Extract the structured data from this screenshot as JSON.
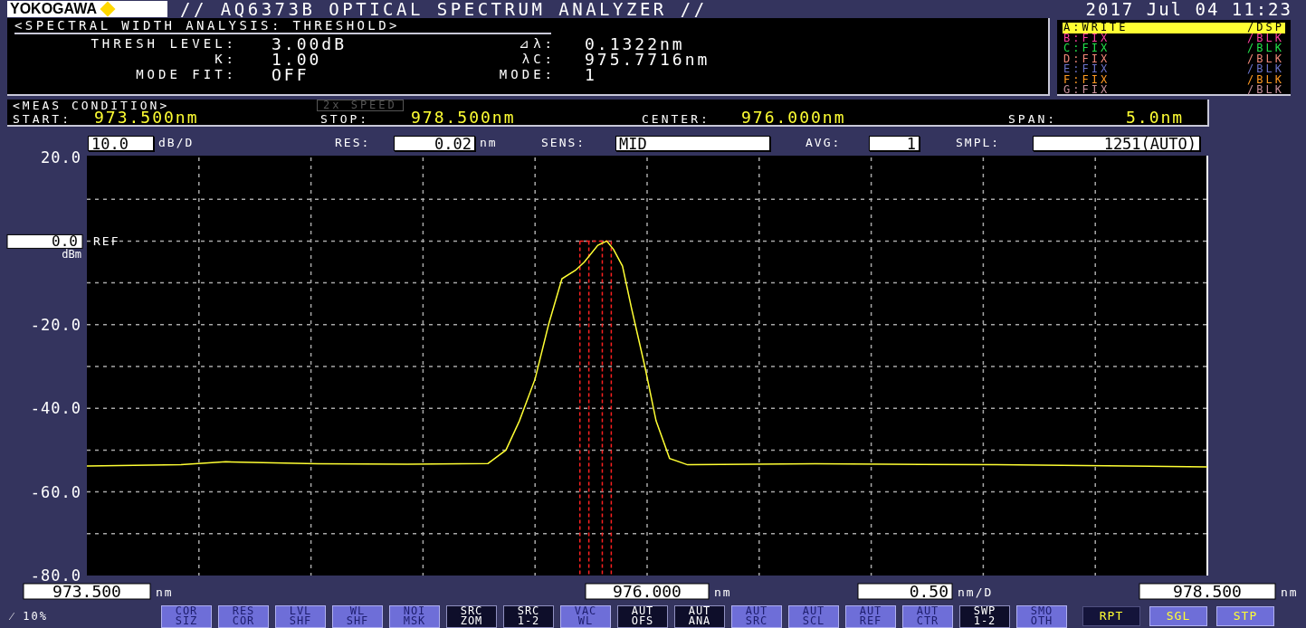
{
  "header": {
    "logo": "YOKOGAWA",
    "title": "// AQ6373B OPTICAL SPECTRUM ANALYZER //",
    "datetime": "2017 Jul 04 11:23"
  },
  "analysis": {
    "title": "<SPECTRAL WIDTH ANALYSIS: THRESHOLD>",
    "left": [
      {
        "label": "THRESH LEVEL:",
        "value": "3.00dB"
      },
      {
        "label": "K:",
        "value": "1.00"
      },
      {
        "label": "MODE FIT:",
        "value": "OFF"
      }
    ],
    "right": [
      {
        "label": "⊿λ:",
        "value": "0.1322nm"
      },
      {
        "label": "λC:",
        "value": "975.7716nm"
      },
      {
        "label": "MODE:",
        "value": "1"
      }
    ]
  },
  "traces": [
    {
      "name": "A:WRITE",
      "mode": "/DSP",
      "color": "#ffff33",
      "selected": true
    },
    {
      "name": "B:FIX",
      "mode": "/BLK",
      "color": "#ff3fa0",
      "selected": false
    },
    {
      "name": "C:FIX",
      "mode": "/BLK",
      "color": "#22e04a",
      "selected": false
    },
    {
      "name": "D:FIX",
      "mode": "/BLK",
      "color": "#f08878",
      "selected": false
    },
    {
      "name": "E:FIX",
      "mode": "/BLK",
      "color": "#6a72c8",
      "selected": false
    },
    {
      "name": "F:FIX",
      "mode": "/BLK",
      "color": "#ff9a22",
      "selected": false
    },
    {
      "name": "G:FIX",
      "mode": "/BLK",
      "color": "#c8909c",
      "selected": false
    }
  ],
  "meas_condition": {
    "title": "<MEAS CONDITION>",
    "speed": {
      "label": "2x SPEED",
      "disabled": true
    },
    "items": [
      {
        "label": "START:",
        "value": "973.500nm"
      },
      {
        "label": "STOP:",
        "value": "978.500nm"
      },
      {
        "label": "CENTER:",
        "value": "976.000nm"
      },
      {
        "label": "SPAN:",
        "value": "5.0nm"
      }
    ]
  },
  "settings": {
    "scale": {
      "value": "10.0",
      "unit": "dB/D"
    },
    "res": {
      "label": "RES:",
      "value": "0.02",
      "unit": "nm"
    },
    "sens": {
      "label": "SENS:",
      "value": "MID"
    },
    "avg": {
      "label": "AVG:",
      "value": "1"
    },
    "smpl": {
      "label": "SMPL:",
      "value": "1251(AUTO)"
    }
  },
  "ref": {
    "value": "0.0",
    "label": "REF",
    "unit": "dBm"
  },
  "chart_data": {
    "type": "line",
    "xlim": [
      973.5,
      978.5
    ],
    "ylim": [
      -80,
      20
    ],
    "xticks": [
      {
        "value": 973.5,
        "label": "973.500"
      },
      {
        "value": 976,
        "label": "976.000"
      },
      {
        "value": 978.5,
        "label": "978.500"
      }
    ],
    "yticks": [
      {
        "value": 20,
        "label": "20.0"
      },
      {
        "value": -20,
        "label": "-20.0"
      },
      {
        "value": -40,
        "label": "-40.0"
      },
      {
        "value": -60,
        "label": "-60.0"
      },
      {
        "value": -80,
        "label": "-80.0"
      }
    ],
    "x": [
      973.5,
      973.92,
      974.12,
      974.53,
      974.93,
      975.29,
      975.37,
      975.43,
      975.5,
      975.56,
      975.62,
      975.68,
      975.72,
      975.78,
      975.82,
      975.85,
      975.89,
      975.93,
      975.99,
      976.04,
      976.1,
      976.18,
      976.75,
      977.56,
      978.5
    ],
    "series": [
      {
        "color": "#ffff33",
        "values": [
          -53.8,
          -53.5,
          -52.8,
          -53.3,
          -53.4,
          -53.2,
          -50,
          -43,
          -33,
          -20,
          -9,
          -7,
          -5,
          -1,
          0,
          -2,
          -6,
          -16,
          -30,
          -43,
          -52,
          -53.5,
          -53.3,
          -53.5,
          -54
        ]
      }
    ],
    "grid": true,
    "ref_lines": [
      {
        "axis": "x",
        "value": 975.7,
        "color": "#ff2020"
      },
      {
        "axis": "x",
        "value": 975.74,
        "color": "#ff2020"
      },
      {
        "axis": "x",
        "value": 975.8,
        "color": "#ff2020"
      },
      {
        "axis": "x",
        "value": 975.84,
        "color": "#ff2020"
      }
    ]
  },
  "x_scale": {
    "tick_units": [
      "nm",
      "nm",
      "nm"
    ],
    "per_div": "0.50",
    "per_div_unit": "nm/D"
  },
  "status": "⁄ 10%",
  "softkeys": [
    {
      "top": "COR",
      "bottom": "SIZ",
      "on": false
    },
    {
      "top": "RES",
      "bottom": "COR",
      "on": false
    },
    {
      "top": "LVL",
      "bottom": "SHF",
      "on": false
    },
    {
      "top": "WL",
      "bottom": "SHF",
      "on": false
    },
    {
      "top": "NOI",
      "bottom": "MSK",
      "on": false
    },
    {
      "top": "SRC",
      "bottom": "ZOM",
      "on": true
    },
    {
      "top": "SRC",
      "bottom": "1-2",
      "on": true
    },
    {
      "top": "VAC",
      "bottom": "WL",
      "on": false
    },
    {
      "top": "AUT",
      "bottom": "OFS",
      "on": true
    },
    {
      "top": "AUT",
      "bottom": "ANA",
      "on": true
    },
    {
      "top": "AUT",
      "bottom": "SRC",
      "on": false
    },
    {
      "top": "AUT",
      "bottom": "SCL",
      "on": false
    },
    {
      "top": "AUT",
      "bottom": "REF",
      "on": false
    },
    {
      "top": "AUT",
      "bottom": "CTR",
      "on": false
    },
    {
      "top": "SWP",
      "bottom": "1-2",
      "on": true
    },
    {
      "top": "SMO",
      "bottom": "OTH",
      "on": false
    }
  ],
  "sweep_keys": [
    {
      "label": "RPT",
      "on": true
    },
    {
      "label": "SGL",
      "on": false
    },
    {
      "label": "STP",
      "on": false
    }
  ]
}
